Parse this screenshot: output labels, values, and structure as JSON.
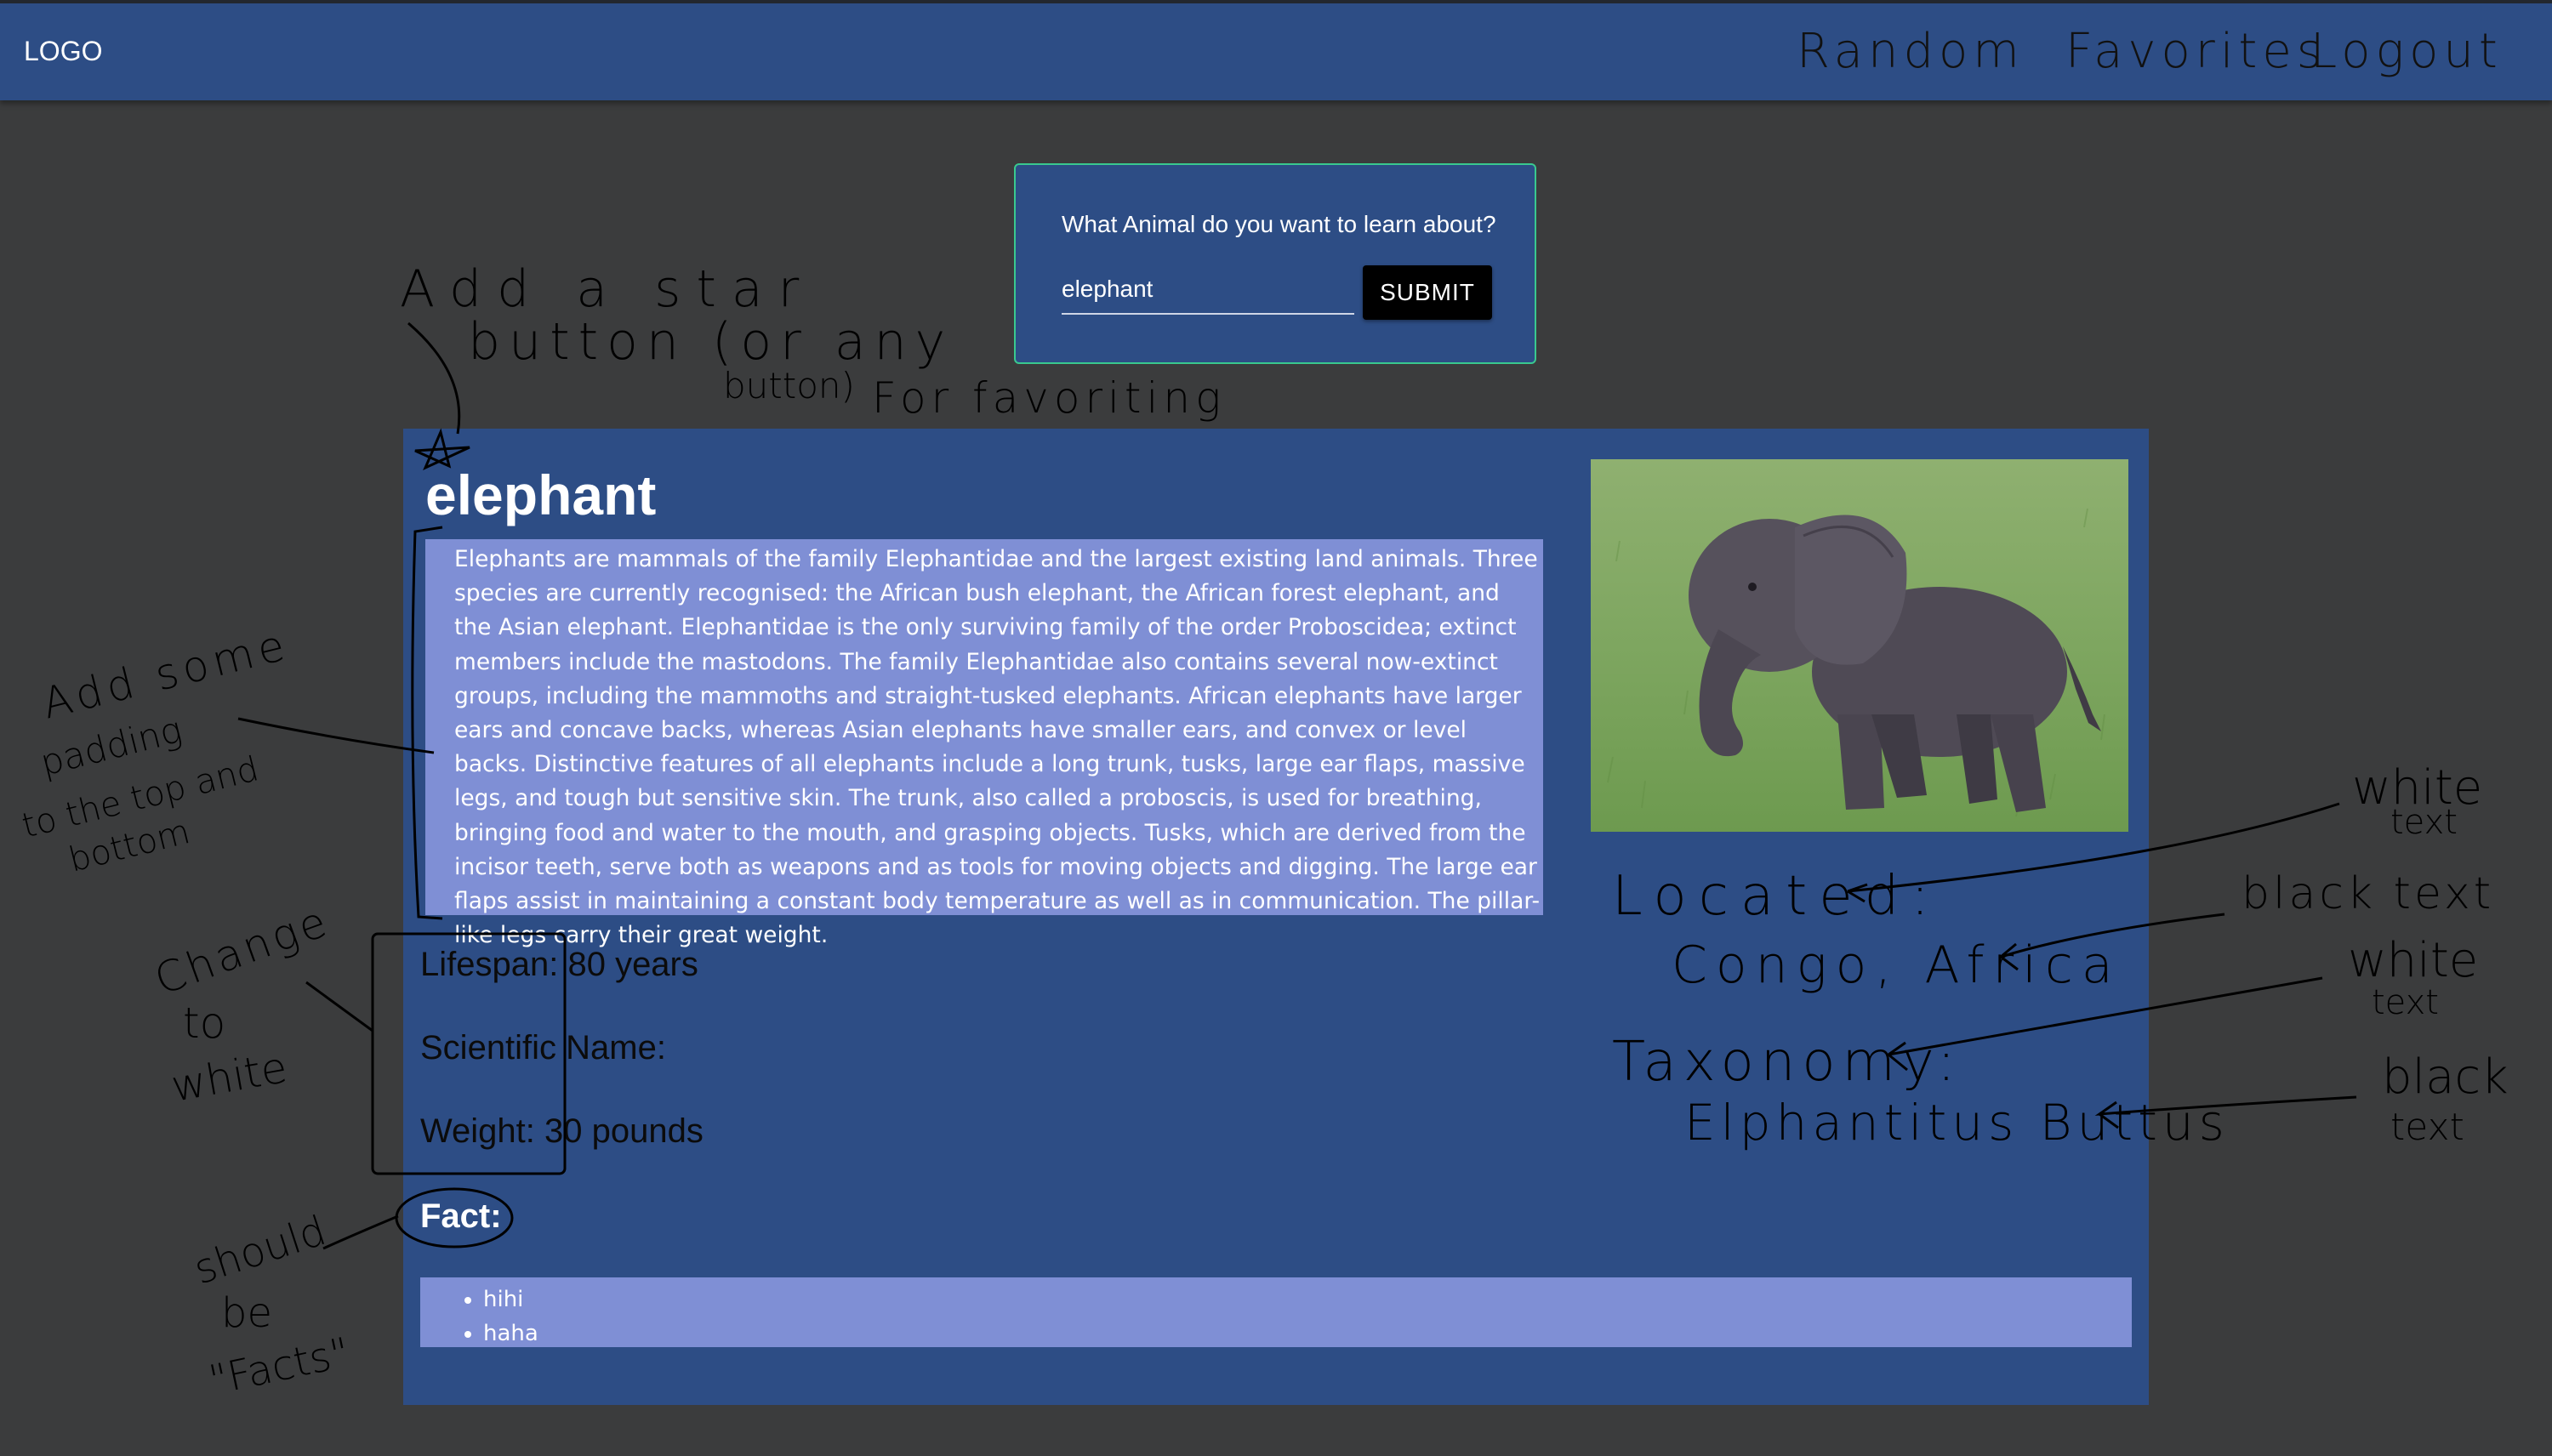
{
  "header": {
    "logo": "LOGO",
    "nav": [
      {
        "label": "Random"
      },
      {
        "label": "Favorites"
      },
      {
        "label": "Logout"
      }
    ]
  },
  "search": {
    "prompt": "What Animal do you want to learn about?",
    "value": "elephant",
    "submit_label": "SUBMIT"
  },
  "animal": {
    "name": "elephant",
    "description": "Elephants are mammals of the family Elephantidae and the largest existing land animals. Three species are currently recognised: the African bush elephant, the African forest elephant, and the Asian elephant. Elephantidae is the only surviving family of the order Proboscidea; extinct members include the mastodons. The family Elephantidae also contains several now-extinct groups, including the mammoths and straight-tusked elephants. African elephants have larger ears and concave backs, whereas Asian elephants have smaller ears, and convex or level backs. Distinctive features of all elephants include a long trunk, tusks, large ear flaps, massive legs, and tough but sensitive skin. The trunk, also called a proboscis, is used for breathing, bringing food and water to the mouth, and grasping objects. Tusks, which are derived from the incisor teeth, serve both as weapons and as tools for moving objects and digging. The large ear flaps assist in maintaining a constant body temperature as well as in communication. The pillar-like legs carry their great weight.",
    "lifespan": "Lifespan: 80 years",
    "scientific_name": "Scientific Name:",
    "weight": "Weight: 30 pounds",
    "fact_label": "Fact:",
    "facts": [
      "hihi",
      "haha"
    ]
  },
  "annotations": {
    "star_note": [
      "Add a star",
      "button (or any",
      "button)",
      "For favoriting"
    ],
    "padding_note": [
      "Add some",
      "padding",
      "to the top and",
      "bottom"
    ],
    "white_note": [
      "Change",
      "to",
      "white"
    ],
    "facts_note": [
      "should",
      "be",
      "\"Facts\""
    ],
    "located_label": "Located:",
    "located_value": "Congo, Africa",
    "taxonomy_label": "Taxonomy:",
    "taxonomy_value": "Elphantitus Buttus",
    "side_notes": [
      "white",
      "text",
      "black text",
      "white",
      "text",
      "black",
      "text"
    ]
  },
  "colors": {
    "background": "#3b3c3d",
    "primary": "#2d4d85",
    "panel_accent": "#7f8fd5",
    "search_border": "#39c98f"
  }
}
